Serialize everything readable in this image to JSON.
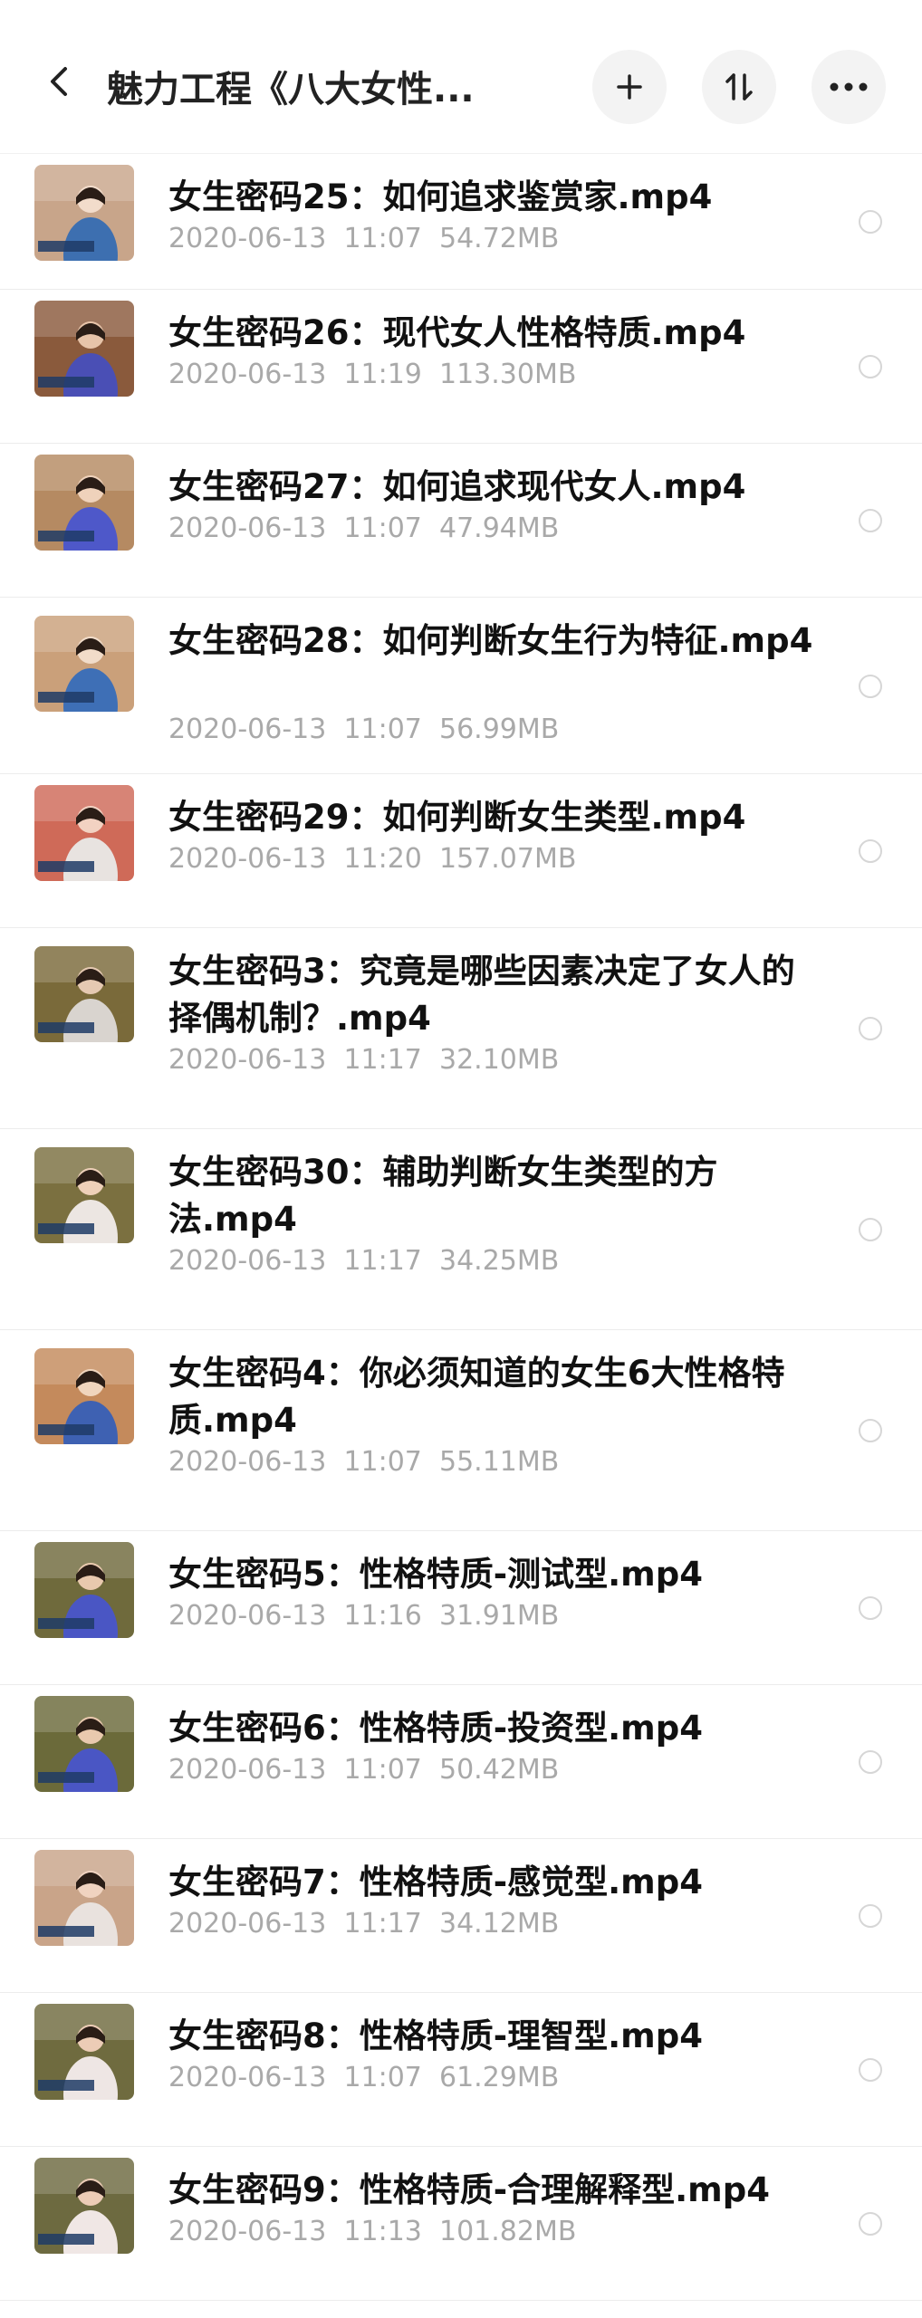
{
  "header": {
    "title": "魅力工程《八大女性...",
    "back_icon": "chevron-left-icon",
    "add_icon": "plus-icon",
    "sort_icon": "sort-icon",
    "more_icon": "more-horizontal-icon"
  },
  "files": [
    {
      "name": "女生密码25：如何追求鉴赏家.mp4",
      "date": "2020-06-13",
      "time": "11:07",
      "size": "54.72MB"
    },
    {
      "name": "女生密码26：现代女人性格特质.mp4",
      "date": "2020-06-13",
      "time": "11:19",
      "size": "113.30MB"
    },
    {
      "name": "女生密码27：如何追求现代女人.mp4",
      "date": "2020-06-13",
      "time": "11:07",
      "size": "47.94MB"
    },
    {
      "name": "女生密码28：如何判断女生行为特征.mp4",
      "date": "2020-06-13",
      "time": "11:07",
      "size": "56.99MB"
    },
    {
      "name": "女生密码29：如何判断女生类型.mp4",
      "date": "2020-06-13",
      "time": "11:20",
      "size": "157.07MB"
    },
    {
      "name": "女生密码3：究竟是哪些因素决定了女人的择偶机制？.mp4",
      "date": "2020-06-13",
      "time": "11:17",
      "size": "32.10MB"
    },
    {
      "name": "女生密码30：辅助判断女生类型的方法.mp4",
      "date": "2020-06-13",
      "time": "11:17",
      "size": "34.25MB"
    },
    {
      "name": "女生密码4：你必须知道的女生6大性格特质.mp4",
      "date": "2020-06-13",
      "time": "11:07",
      "size": "55.11MB"
    },
    {
      "name": "女生密码5：性格特质-测试型.mp4",
      "date": "2020-06-13",
      "time": "11:16",
      "size": "31.91MB"
    },
    {
      "name": "女生密码6：性格特质-投资型.mp4",
      "date": "2020-06-13",
      "time": "11:07",
      "size": "50.42MB"
    },
    {
      "name": "女生密码7：性格特质-感觉型.mp4",
      "date": "2020-06-13",
      "time": "11:17",
      "size": "34.12MB"
    },
    {
      "name": "女生密码8：性格特质-理智型.mp4",
      "date": "2020-06-13",
      "time": "11:07",
      "size": "61.29MB"
    },
    {
      "name": "女生密码9：性格特质-合理解释型.mp4",
      "date": "2020-06-13",
      "time": "11:13",
      "size": "101.82MB"
    }
  ]
}
